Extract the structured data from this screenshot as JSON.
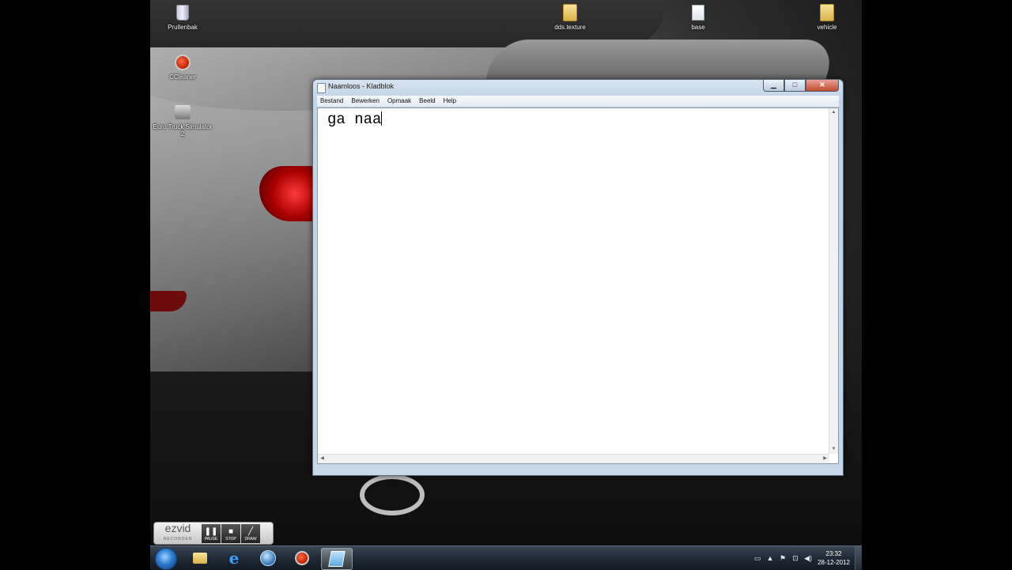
{
  "desktop": {
    "icons": [
      {
        "label": "Prullenbak",
        "icon": "recycle-bin-icon"
      },
      {
        "label": "CCleaner",
        "icon": "ccleaner-icon"
      },
      {
        "label": "Euro Truck Simulator 2",
        "icon": "euro-truck-simulator-icon"
      },
      {
        "label": "dds.texture",
        "icon": "folder-icon"
      },
      {
        "label": "base",
        "icon": "file-icon"
      },
      {
        "label": "vehicle",
        "icon": "folder-icon"
      }
    ]
  },
  "notepad": {
    "title": "Naamloos - Kladblok",
    "menu": [
      "Bestand",
      "Bewerken",
      "Opmaak",
      "Beeld",
      "Help"
    ],
    "content": "ga naa",
    "buttons": {
      "minimize": "▁",
      "maximize": "□",
      "close": "✕"
    }
  },
  "ezvid": {
    "logo": "ezvid",
    "subtitle": "RECORDER",
    "buttons": [
      "PAUSE",
      "STOP",
      "DRAW"
    ]
  },
  "taskbar": {
    "apps": [
      "windows-explorer-icon",
      "internet-explorer-icon",
      "globe-icon",
      "ccleaner-icon",
      "notepad-icon"
    ],
    "time": "23:32",
    "date": "28-12-2012"
  }
}
